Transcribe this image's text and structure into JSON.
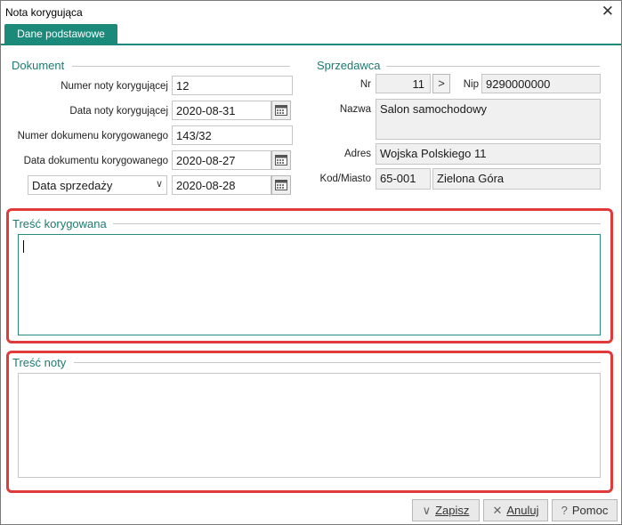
{
  "window": {
    "title": "Nota korygująca",
    "close_glyph": "✕"
  },
  "tabs": [
    {
      "label": "Dane podstawowe"
    }
  ],
  "dokument": {
    "section_title": "Dokument",
    "numer_noty_label": "Numer noty korygującej",
    "numer_noty_value": "12",
    "data_noty_label": "Data noty korygującej",
    "data_noty_value": "2020-08-31",
    "numer_dok_label": "Numer dokumenu korygowanego",
    "numer_dok_value": "143/32",
    "data_dok_label": "Data dokumentu korygowanego",
    "data_dok_value": "2020-08-27",
    "data_type_select": "Data sprzedaży",
    "data_sprzedazy_value": "2020-08-28"
  },
  "sprzedawca": {
    "section_title": "Sprzedawca",
    "nr_label": "Nr",
    "nr_value": "11",
    "nip_label": "Nip",
    "nip_value": "9290000000",
    "nazwa_label": "Nazwa",
    "nazwa_value": "Salon samochodowy",
    "adres_label": "Adres",
    "adres_value": "Wojska Polskiego 11",
    "kod_label": "Kod/Miasto",
    "kod_value": "65-001",
    "miasto_value": "Zielona Góra"
  },
  "tresc_korygowana": {
    "section_title": "Treść korygowana",
    "value": ""
  },
  "tresc_noty": {
    "section_title": "Treść noty",
    "value": ""
  },
  "buttons": {
    "zapisz": "Zapisz",
    "anuluj": "Anuluj",
    "pomoc": "Pomoc"
  },
  "colors": {
    "accent": "#1c8a7b",
    "highlight": "#e03a3a"
  }
}
